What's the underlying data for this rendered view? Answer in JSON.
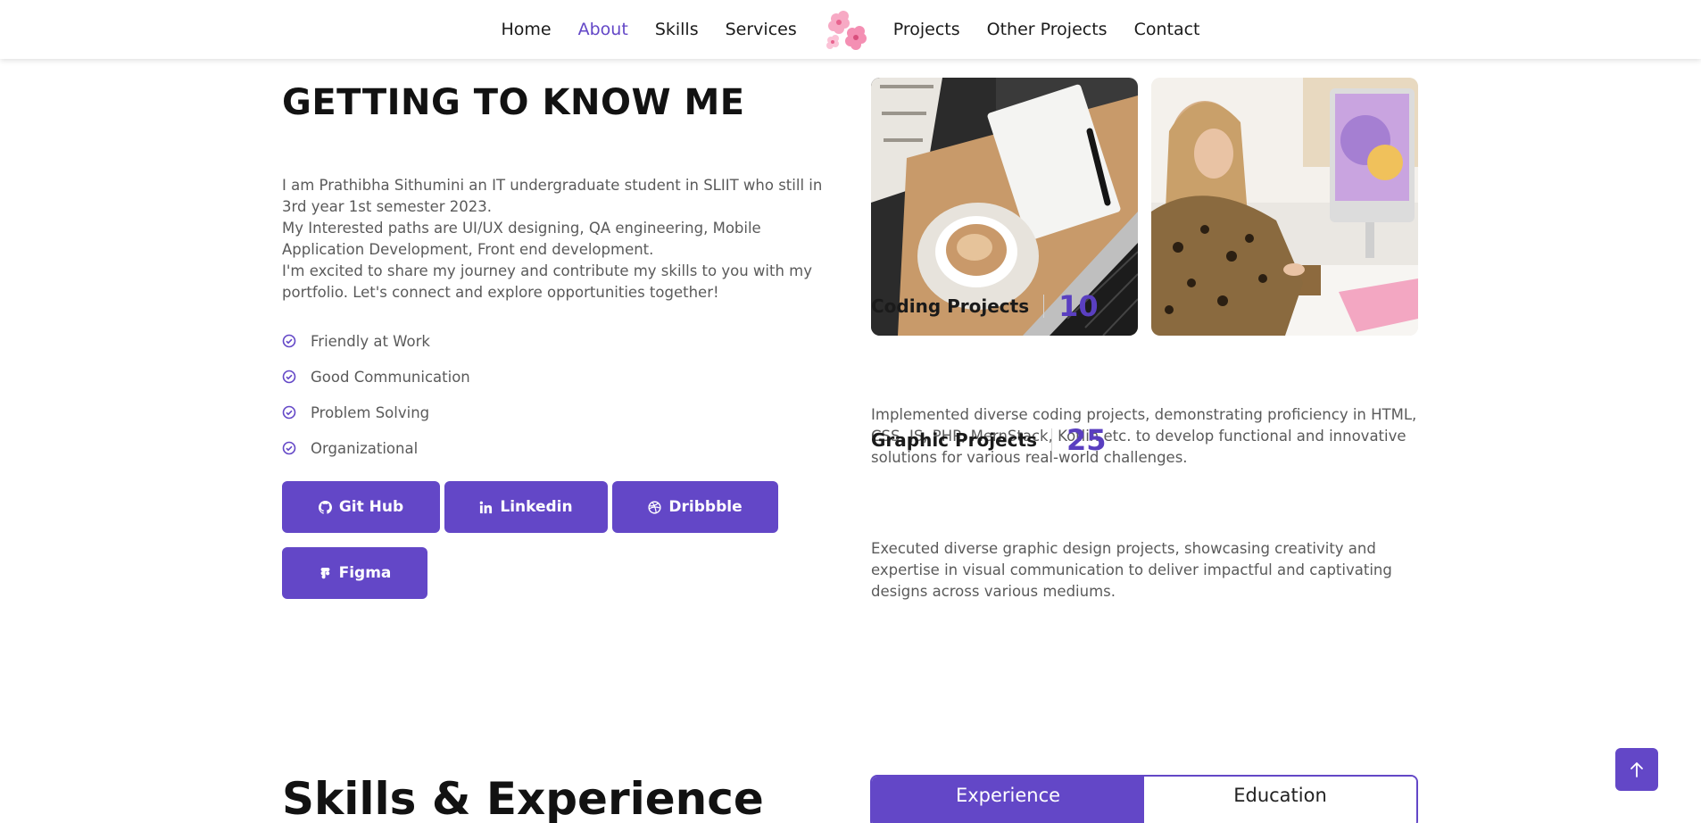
{
  "nav": {
    "items": [
      "Home",
      "About",
      "Skills",
      "Services",
      "Projects",
      "Other Projects",
      "Contact"
    ],
    "active": "About",
    "logo_icon": "sakura-flower-icon"
  },
  "about": {
    "heading": "GETTING TO KNOW ME",
    "bio": [
      "I am Prathibha Sithumini an IT undergraduate student in SLIIT who still in 3rd year 1st semester 2023.",
      "My Interested paths are UI/UX designing, QA engineering, Mobile Application Development, Front end development.",
      "I'm excited to share my journey and contribute my skills to you with my portfolio. Let's connect and explore opportunities together!"
    ],
    "traits": [
      "Friendly at Work",
      "Good Communication",
      "Problem Solving",
      "Organizational"
    ],
    "buttons": [
      {
        "label": "Git Hub",
        "icon": "github-icon"
      },
      {
        "label": "Linkedin",
        "icon": "linkedin-icon"
      },
      {
        "label": "Dribbble",
        "icon": "dribbble-icon"
      },
      {
        "label": "Figma",
        "icon": "figma-icon"
      }
    ]
  },
  "stats": [
    {
      "label": "Coding Projects",
      "value": "10",
      "description": "Implemented diverse coding projects, demonstrating proficiency in HTML, CSS, JS, PHP, MernStack, Kotlin etc. to develop functional and innovative solutions for various real-world challenges."
    },
    {
      "label": "Graphic Projects",
      "value": "25",
      "description": "Executed diverse graphic design projects, showcasing creativity and expertise in visual communication to deliver impactful and captivating designs across various mediums."
    }
  ],
  "skills": {
    "heading": "Skills & Experience",
    "tabs": [
      "Experience",
      "Education"
    ],
    "active_tab": "Experience"
  },
  "colors": {
    "accent": "#6347c7",
    "stat_value": "#5a3fc0"
  },
  "back_to_top_icon": "arrow-up-icon"
}
